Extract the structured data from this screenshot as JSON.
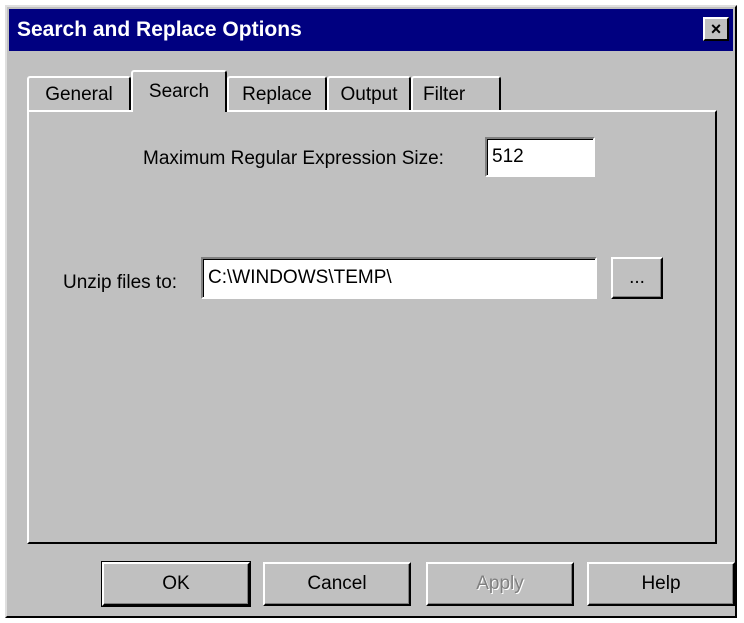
{
  "window": {
    "title": "Search and Replace Options",
    "close_glyph": "×"
  },
  "tabs": [
    {
      "label": "General",
      "active": false
    },
    {
      "label": "Search",
      "active": true
    },
    {
      "label": "Replace",
      "active": false
    },
    {
      "label": "Output",
      "active": false
    },
    {
      "label": "Filter",
      "active": false
    }
  ],
  "search_tab": {
    "max_regex_label": "Maximum Regular Expression Size:",
    "max_regex_value": "512",
    "unzip_label": "Unzip files to:",
    "unzip_value": "C:\\WINDOWS\\TEMP\\",
    "browse_label": "..."
  },
  "buttons": {
    "ok": "OK",
    "cancel": "Cancel",
    "apply": "Apply",
    "help": "Help"
  },
  "colors": {
    "titlebar": "#000080",
    "face": "#c0c0c0"
  }
}
